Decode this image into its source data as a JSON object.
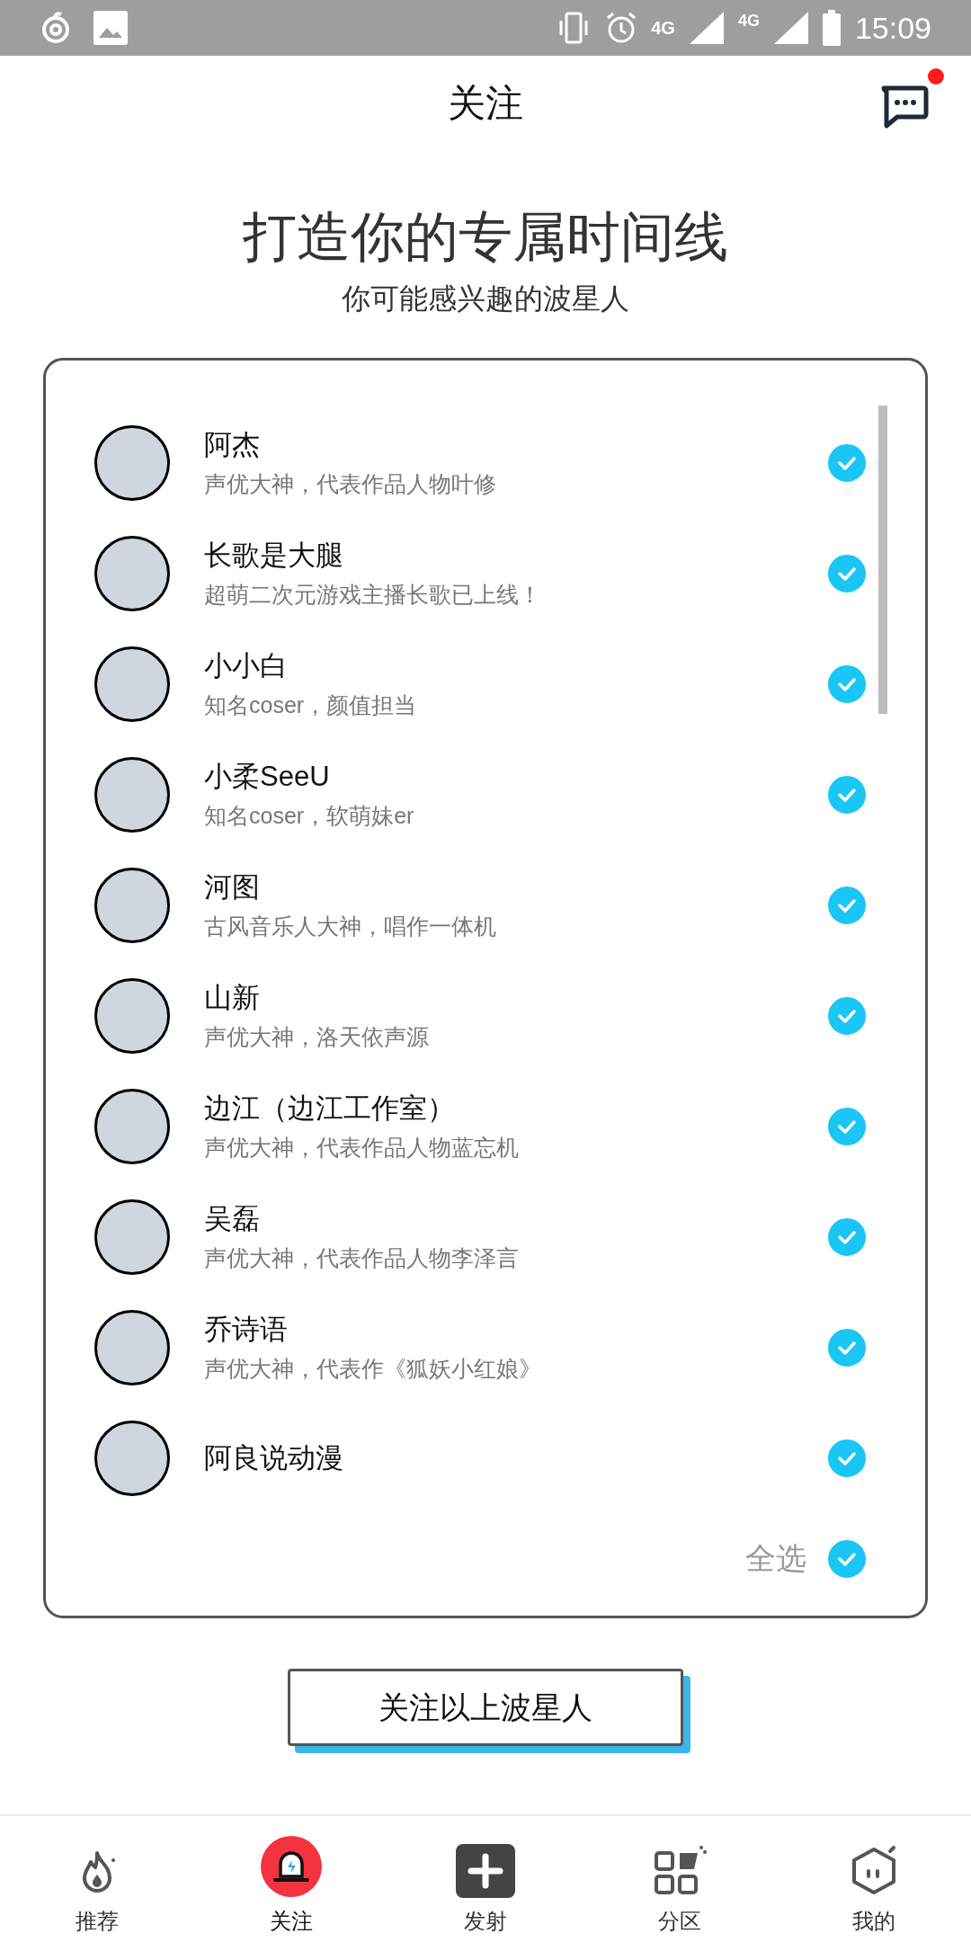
{
  "status_bar": {
    "time": "15:09",
    "network_1": "4G",
    "network_2": "4G"
  },
  "header": {
    "title": "关注",
    "has_notification": true
  },
  "intro": {
    "title": "打造你的专属时间线",
    "subtitle": "你可能感兴趣的波星人"
  },
  "recommendations": [
    {
      "name": "阿杰",
      "description": "声优大神，代表作品人物叶修",
      "checked": true
    },
    {
      "name": "长歌是大腿",
      "description": "超萌二次元游戏主播长歌已上线！",
      "checked": true
    },
    {
      "name": "小小白",
      "description": "知名coser，颜值担当",
      "checked": true
    },
    {
      "name": "小柔SeeU",
      "description": "知名coser，软萌妹er",
      "checked": true
    },
    {
      "name": "河图",
      "description": "古风音乐人大神，唱作一体机",
      "checked": true
    },
    {
      "name": "山新",
      "description": "声优大神，洛天依声源",
      "checked": true
    },
    {
      "name": "边江（边江工作室）",
      "description": "声优大神，代表作品人物蓝忘机",
      "checked": true
    },
    {
      "name": "吴磊",
      "description": "声优大神，代表作品人物李泽言",
      "checked": true
    },
    {
      "name": "乔诗语",
      "description": "声优大神，代表作《狐妖小红娘》",
      "checked": true
    },
    {
      "name": "阿良说动漫",
      "checked": true
    }
  ],
  "select_all": {
    "label": "全选",
    "checked": true
  },
  "follow_button": "关注以上波星人",
  "bottom_nav": [
    {
      "label": "推荐",
      "kind": "fire",
      "selected": false
    },
    {
      "label": "关注",
      "kind": "beacon",
      "selected": true
    },
    {
      "label": "发射",
      "kind": "plus",
      "selected": false
    },
    {
      "label": "分区",
      "kind": "grid",
      "selected": false
    },
    {
      "label": "我的",
      "kind": "cube",
      "selected": false
    }
  ]
}
